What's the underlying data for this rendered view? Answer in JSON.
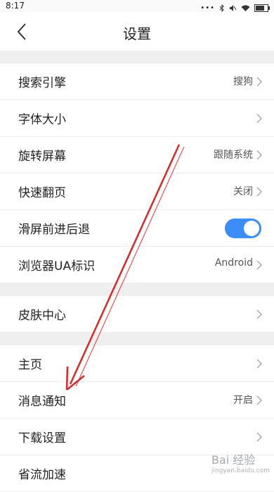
{
  "status": {
    "time": "8:17",
    "icons": [
      "signal-dots-icon",
      "bluetooth-icon",
      "mute-icon",
      "wifi-icon",
      "battery-icon"
    ]
  },
  "header": {
    "title": "设置"
  },
  "rows": [
    {
      "label": "搜索引擎",
      "value": "搜狗"
    },
    {
      "label": "字体大小",
      "value": ""
    },
    {
      "label": "旋转屏幕",
      "value": "跟随系统"
    },
    {
      "label": "快速翻页",
      "value": "关闭"
    },
    {
      "label": "滑屏前进后退",
      "toggle": true
    },
    {
      "label": "浏览器UA标识",
      "value": "Android"
    },
    {
      "label": "皮肤中心",
      "value": ""
    },
    {
      "label": "主页",
      "value": ""
    },
    {
      "label": "消息通知",
      "value": "开启"
    },
    {
      "label": "下载设置",
      "value": ""
    },
    {
      "label": "省流加速",
      "value": ""
    }
  ],
  "watermark": {
    "text": "Bai 经验",
    "sub": "jingyan.baidu.com"
  },
  "colors": {
    "toggle_on": "#3c8df6",
    "annotation_arrow": "#d42a2a",
    "section_gap": "#efefef"
  }
}
